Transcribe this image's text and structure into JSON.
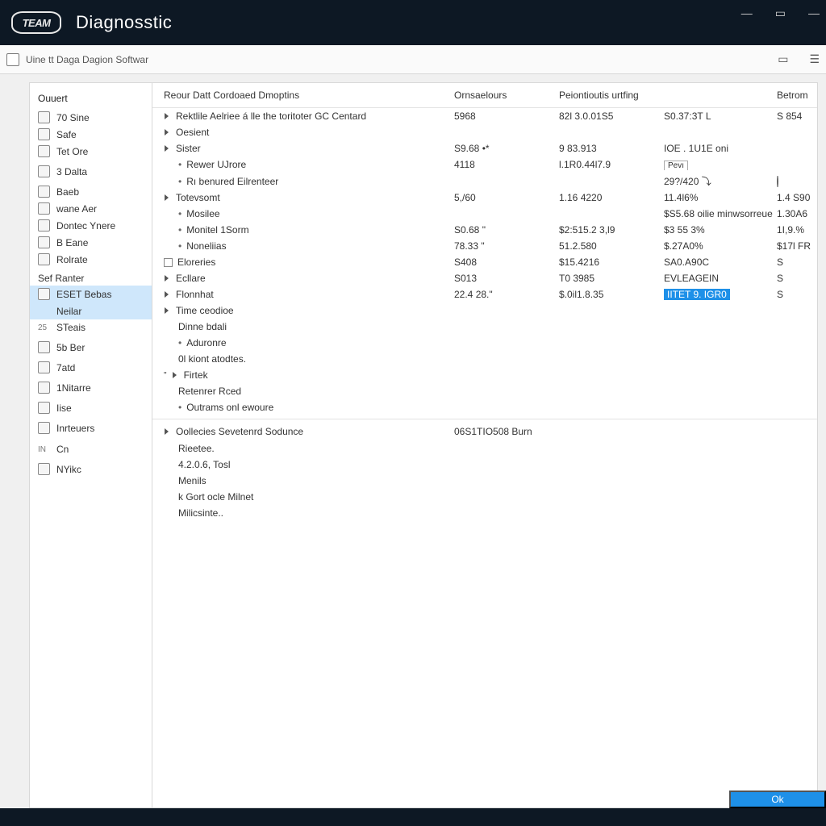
{
  "titlebar": {
    "logo_text": "TEAM",
    "app_title": "Diagnosstic"
  },
  "subheader": {
    "title": "Uine tt Daga Dagion Softwar"
  },
  "sidebar": {
    "heading": "Ouuert",
    "items": [
      {
        "label": "70 Sine"
      },
      {
        "label": "Safe"
      },
      {
        "label": "Tet Ore"
      },
      {
        "label": "3 Dalta"
      },
      {
        "label": "Baeb"
      },
      {
        "label": "wane Aer"
      },
      {
        "label": "Dontec Ynere"
      },
      {
        "label": "B Eane"
      },
      {
        "label": "Rolrate"
      }
    ],
    "section1_label": "Sef Ranter",
    "active_items": [
      {
        "label": "ESET Bebas"
      },
      {
        "label": "Neilar",
        "noicon": true
      }
    ],
    "items2": [
      {
        "label": "STeais",
        "pre": "25"
      },
      {
        "label": "5b Ber"
      },
      {
        "label": "7atd"
      },
      {
        "label": "1Nitarre"
      },
      {
        "label": "Iise"
      },
      {
        "label": "Inrteuers"
      },
      {
        "label": "Cn",
        "pre": "IN"
      },
      {
        "label": "NYikc"
      }
    ]
  },
  "columns": {
    "c0": "Reour Datt Cordoaed Dmoptins",
    "c1": "Ornsaelours",
    "c2": "Peiontioutis urtfing",
    "c3": "",
    "c4": "Betrom"
  },
  "rows": [
    {
      "type": "top",
      "name": "Rektlile Aelriee á lle the toritoter GC Centard",
      "c1": "5968",
      "c2": "82l 3.0.01S5",
      "c3": "S0.37:3T L",
      "c4": "S 854"
    },
    {
      "type": "top",
      "name": "Oesient",
      "c1": "",
      "c2": "",
      "c3": "",
      "c4": ""
    },
    {
      "type": "top",
      "name": "Sister",
      "c1": "S9.68 •*",
      "c2": "9 83.913",
      "c3": "IOE .  1U1E oni",
      "c4": ""
    },
    {
      "type": "child",
      "name": "Rewer UJrore",
      "c1": "4118",
      "c2": "l.1R0.44l7.9",
      "c3_box": "Pevı",
      "c4": ""
    },
    {
      "type": "child",
      "name": "Rı benured Eilrenteer",
      "c1": "",
      "c2": "",
      "c3": "29?/420 ⤵",
      "c4": "",
      "gear": true
    },
    {
      "type": "top",
      "name": "Totevsomt",
      "c1": "5,/60",
      "c2": "1.16  4220",
      "c3": "11.4l6%",
      "c4": "1.4 S90"
    },
    {
      "type": "child",
      "name": "Mosilee",
      "c1": "",
      "c2": "",
      "c3": "$S5.68 oilie minwsorreue",
      "c4": "1.30A6"
    },
    {
      "type": "child",
      "name": "Monitel 1Sorm",
      "c1": "S0.68 \"",
      "c2": "$2:515.2 3,l9",
      "c3": "$3 55 3%",
      "c4": "1I,9.%"
    },
    {
      "type": "child",
      "name": "Noneliias",
      "c1": "78.33 \"",
      "c2": "51.2.580",
      "c3": "$.27A0%",
      "c4": "$17l FR"
    },
    {
      "type": "chk",
      "name": "Eloreries",
      "c1": "S408",
      "c2": "$15.4216",
      "c3": "SA0.A90C",
      "c4": "S"
    },
    {
      "type": "top",
      "name": "Ecllare",
      "c1": "S013",
      "c2": "T0 3985",
      "c3": "EVLEAGEIN",
      "c4": "S"
    },
    {
      "type": "top",
      "name": "Flonnhat",
      "c1": "22.4 28.\"",
      "c2": "$.0il1.8.35",
      "c3_hl": "IITET 9. IGR0",
      "c4": "S"
    },
    {
      "type": "top",
      "name": "Time ceodioe",
      "c1": "",
      "c2": "",
      "c3": "",
      "c4": ""
    },
    {
      "type": "child2",
      "name": "Dinne bdali"
    },
    {
      "type": "child",
      "name": "Aduronre"
    },
    {
      "type": "child2",
      "name": "0l kiont atodtes."
    },
    {
      "type": "top",
      "name": "Firtek",
      "mark": "\""
    },
    {
      "type": "child2",
      "name": "Retenrer Rced"
    },
    {
      "type": "child",
      "name": "Outrams onl ewoure"
    }
  ],
  "section2": {
    "header": {
      "name": "Oollecies Sevetenrd Sodunce",
      "c1": "06S1TIO508 Burn"
    },
    "items": [
      {
        "name": "Rieetee."
      },
      {
        "name": "4.2.0.6, Tosl"
      },
      {
        "name": "Menils"
      },
      {
        "name": "k Gort ocle Milnet"
      },
      {
        "name": "Milicsinte.."
      }
    ]
  },
  "footer": {
    "ok": "Ok"
  }
}
